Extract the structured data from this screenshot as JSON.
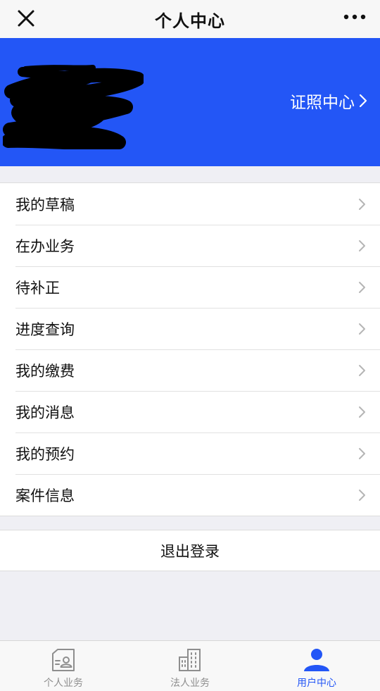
{
  "header": {
    "title": "个人中心",
    "close_icon": "close-icon",
    "more_icon": "more-dots-icon"
  },
  "banner": {
    "background_color": "#2356f6",
    "link_label": "证照中心",
    "link_icon": "chevron-right-icon"
  },
  "menu": {
    "items": [
      {
        "label": "我的草稿"
      },
      {
        "label": "在办业务"
      },
      {
        "label": "待补正"
      },
      {
        "label": "进度查询"
      },
      {
        "label": "我的缴费"
      },
      {
        "label": "我的消息"
      },
      {
        "label": "我的预约"
      },
      {
        "label": "案件信息"
      }
    ]
  },
  "logout": {
    "label": "退出登录"
  },
  "tabbar": {
    "active_color": "#2356f6",
    "tabs": [
      {
        "label": "个人业务",
        "icon": "id-card-icon",
        "active": false
      },
      {
        "label": "法人业务",
        "icon": "building-icon",
        "active": false
      },
      {
        "label": "用户中心",
        "icon": "user-icon",
        "active": true
      }
    ]
  }
}
